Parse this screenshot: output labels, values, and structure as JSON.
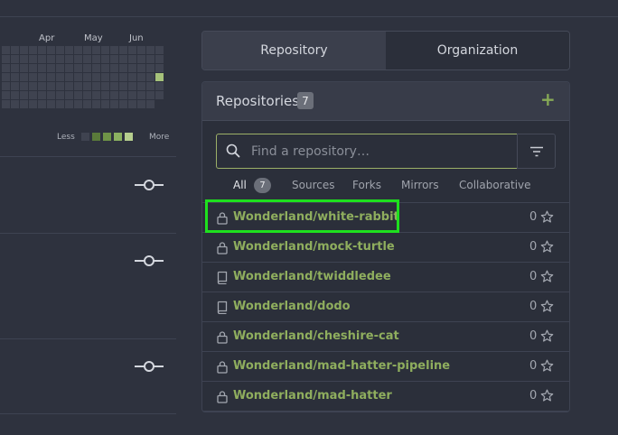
{
  "heatmap": {
    "months": [
      "Apr",
      "May",
      "Jun"
    ],
    "legend_less": "Less",
    "legend_more": "More",
    "legend_colors": [
      "#3f4350",
      "#5a7a3a",
      "#6f9447",
      "#8bb160",
      "#b6cf8e"
    ],
    "cell_color": "#3f4350",
    "active_cell_color": "#a6c27a"
  },
  "tabs": [
    {
      "label": "Repository",
      "active": true
    },
    {
      "label": "Organization",
      "active": false
    }
  ],
  "repositories": {
    "title": "Repositories",
    "count": "7",
    "search_placeholder": "Find a repository…",
    "filters": {
      "all": "All",
      "all_count": "7",
      "sources": "Sources",
      "forks": "Forks",
      "mirrors": "Mirrors",
      "collaborative": "Collaborative"
    },
    "items": [
      {
        "name": "Wonderland/white-rabbit",
        "stars": "0",
        "icon": "lock-icon"
      },
      {
        "name": "Wonderland/mock-turtle",
        "stars": "0",
        "icon": "lock-icon"
      },
      {
        "name": "Wonderland/twiddledee",
        "stars": "0",
        "icon": "repo-book-icon"
      },
      {
        "name": "Wonderland/dodo",
        "stars": "0",
        "icon": "repo-book-icon"
      },
      {
        "name": "Wonderland/cheshire-cat",
        "stars": "0",
        "icon": "lock-icon"
      },
      {
        "name": "Wonderland/mad-hatter-pipeline",
        "stars": "0",
        "icon": "lock-icon"
      },
      {
        "name": "Wonderland/mad-hatter",
        "stars": "0",
        "icon": "lock-icon"
      }
    ]
  },
  "colors": {
    "accent": "#8fae5e",
    "highlight": "#1ee01e"
  }
}
